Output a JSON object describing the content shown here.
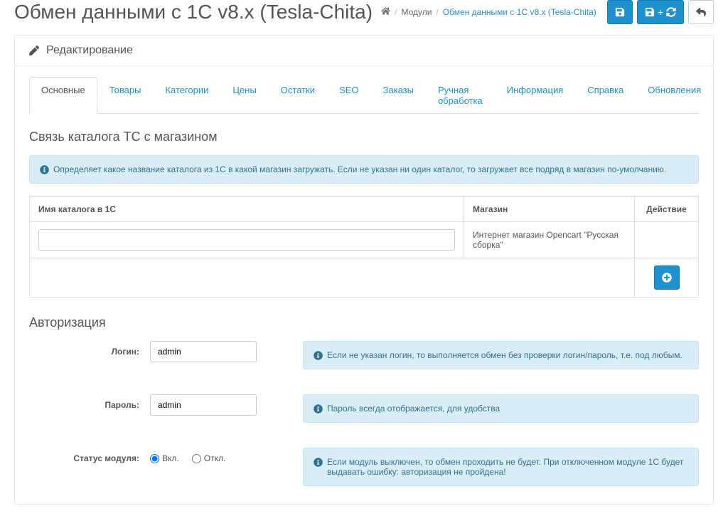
{
  "header": {
    "title": "Обмен данными с 1С v8.x (Tesla-Chita)",
    "breadcrumb": {
      "modules": "Модули",
      "current": "Обмен данными с 1С v8.x (Tesla-Chita)"
    }
  },
  "panel_heading": "Редактирование",
  "tabs": [
    "Основные",
    "Товары",
    "Категории",
    "Цены",
    "Остатки",
    "SEO",
    "Заказы",
    "Ручная обработка",
    "Информация",
    "Справка",
    "Обновления"
  ],
  "catalog": {
    "legend": "Связь каталога ТС с магазином",
    "info": "Определяет какое название каталога из 1С в какой магазин загружать. Если не указан ни один каталог, то загружает все подряд в магазин по-умолчанию.",
    "columns": {
      "name": "Имя каталога в 1С",
      "store": "Магазин",
      "action": "Действие"
    },
    "row": {
      "name_value": "",
      "store_text": "Интернет магазин Opencart \"Русская сборка\""
    }
  },
  "auth": {
    "legend": "Авторизация",
    "login_label": "Логин:",
    "login_value": "admin",
    "login_info": "Если не указан логин, то выполняется обмен без проверки логин/пароль, т.е. под любым.",
    "password_label": "Пароль:",
    "password_value": "admin",
    "password_info": "Пароль всегда отображается, для удобства",
    "status_label": "Статус модуля:",
    "status_on": "Вкл.",
    "status_off": "Откл.",
    "status_info": "Если модуль выключен, то обмен проходить не будет. При отключенном модуле 1С будет выдавать ошибку: авторизация не пройдена!"
  }
}
